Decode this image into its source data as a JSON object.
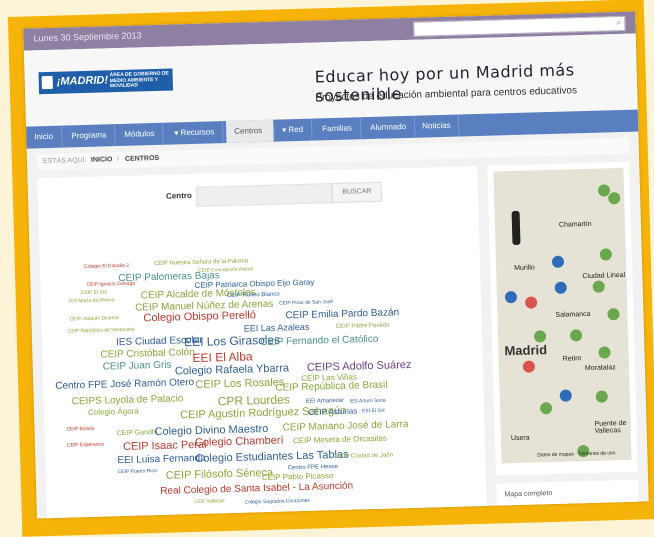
{
  "topbar": {
    "date": "Lunes 30 Septiembre 2013",
    "search_placeholder": ""
  },
  "logo": {
    "madrid": "¡MADRID!",
    "area": "ÁREA DE GOBIERNO DE MEDIO AMBIENTE Y MOVILIDAD"
  },
  "site": {
    "title": "Educar hoy por un Madrid más sostenible",
    "subtitle": "Proyectos de educación ambiental para centros educativos"
  },
  "nav": {
    "items": [
      "Inicio",
      "Programa",
      "Módulos",
      "▾ Recursos",
      "Centros",
      "▾ Red",
      "Familias",
      "Alumnado",
      "Noticias"
    ]
  },
  "breadcrumb": {
    "prefix": "ESTÁS AQUÍ:",
    "home": "INICIO",
    "sep": "/",
    "current": "CENTROS"
  },
  "search": {
    "label": "Centro",
    "button": "BUSCAR"
  },
  "centros": [
    {
      "name": "Colegio El Estudio 2",
      "color": "#c0392b"
    },
    {
      "name": "CEIP Nuestra Señora de la Paloma",
      "color": "#8aa83a"
    },
    {
      "name": "CEIP Concepción Arenal",
      "color": "#8aa83a"
    },
    {
      "name": "CEIP Palomeras Bajas",
      "color": "#4a8f8f"
    },
    {
      "name": "CEIP Ignacio Zuloaga",
      "color": "#c0392b"
    },
    {
      "name": "CEIP Patriarca Obispo Eijo Garay",
      "color": "#2e5e9e"
    },
    {
      "name": "CEIP El Sol",
      "color": "#8aa83a"
    },
    {
      "name": "CEIP Alcalde de Móstoles",
      "color": "#8aa83a"
    },
    {
      "name": "CEIP Rufino Blanco",
      "color": "#2e5e9e"
    },
    {
      "name": "IES María de Molina",
      "color": "#8aa83a"
    },
    {
      "name": "CEIP Manuel Núñez de Arenas",
      "color": "#8aa83a"
    },
    {
      "name": "CEIP Pinar de San José",
      "color": "#2e5e9e"
    },
    {
      "name": "CEIP Joaquín Dicenta",
      "color": "#8aa83a"
    },
    {
      "name": "Colegio Obispo Perelló",
      "color": "#c0392b"
    },
    {
      "name": "CEIP Emilia Pardo Bazán",
      "color": "#2e5e9e"
    },
    {
      "name": "CEIP República de Venezuela",
      "color": "#8aa83a"
    },
    {
      "name": "EEI Las Azaleas",
      "color": "#2e5e9e"
    },
    {
      "name": "CEIP Padre Poveda",
      "color": "#8aa83a"
    },
    {
      "name": "IES Ciudad Escolar",
      "color": "#2e5e9e"
    },
    {
      "name": "EEI Los Girasoles",
      "color": "#2e5e9e"
    },
    {
      "name": "CEIP Fernando el Católico",
      "color": "#4a8f8f"
    },
    {
      "name": "CEIP Cristóbal Colón",
      "color": "#8aa83a"
    },
    {
      "name": "EEI El Alba",
      "color": "#c0392b"
    },
    {
      "name": "CEIP Juan Gris",
      "color": "#4a8f8f"
    },
    {
      "name": "Colegio Rafaela Ybarra",
      "color": "#2e5e9e"
    },
    {
      "name": "CEIPS Adolfo Suárez",
      "color": "#6a3d8f"
    },
    {
      "name": "CEIP Las Viñas",
      "color": "#8aa83a"
    },
    {
      "name": "Centro FPE José Ramón Otero",
      "color": "#2e5e9e"
    },
    {
      "name": "CEIP Los Rosales",
      "color": "#8aa83a"
    },
    {
      "name": "CEIP República de Brasil",
      "color": "#8aa83a"
    },
    {
      "name": "CEIPS Loyola de Palacio",
      "color": "#8aa83a"
    },
    {
      "name": "CPR Lourdes",
      "color": "#8aa83a"
    },
    {
      "name": "EEI Amanecer",
      "color": "#2e5e9e"
    },
    {
      "name": "IES Arturo Soria",
      "color": "#2e5e9e"
    },
    {
      "name": "Colegio Ágora",
      "color": "#8aa83a"
    },
    {
      "name": "CEIP Agustín Rodríguez Sahagún",
      "color": "#8aa83a"
    },
    {
      "name": "CEIP Asturias",
      "color": "#2e5e9e"
    },
    {
      "name": "EEI El Sol",
      "color": "#2e5e9e"
    },
    {
      "name": "CEIP Bolivia",
      "color": "#c0392b"
    },
    {
      "name": "CEIP Gandhi",
      "color": "#8aa83a"
    },
    {
      "name": "Colegio Divino Maestro",
      "color": "#2e5e9e"
    },
    {
      "name": "CEIP Mariano José de Larra",
      "color": "#8aa83a"
    },
    {
      "name": "CEIP Esperanza",
      "color": "#c0392b"
    },
    {
      "name": "CEIP Isaac Peral",
      "color": "#c0392b"
    },
    {
      "name": "Colegio Chamberí",
      "color": "#c0392b"
    },
    {
      "name": "CEIP Meseta de Orcasitas",
      "color": "#8aa83a"
    },
    {
      "name": "EEI Luisa Fernanda",
      "color": "#2e5e9e"
    },
    {
      "name": "Colegio Estudiantes Las Tablas",
      "color": "#2e5e9e"
    },
    {
      "name": "CEIP Ciudad de Jaén",
      "color": "#8aa83a"
    },
    {
      "name": "CEIP Puerto Rico",
      "color": "#2e5e9e"
    },
    {
      "name": "CEIP Filósofo Séneca",
      "color": "#8aa83a"
    },
    {
      "name": "Centro FPE Hease",
      "color": "#2e5e9e"
    },
    {
      "name": "CEIP Pablo Picasso",
      "color": "#8aa83a"
    },
    {
      "name": "Real Colegio de Santa Isabel - La Asunción",
      "color": "#c0392b"
    },
    {
      "name": "CEE Vallecas",
      "color": "#8aa83a"
    },
    {
      "name": "Colegio Sagrados Corazones",
      "color": "#2e5e9e"
    }
  ],
  "map": {
    "labels": [
      "Chamartín",
      "Murillo",
      "Ciudad Lineal",
      "Salamanca",
      "Madrid",
      "Retiro",
      "Moratalaz",
      "Puente de Vallecas",
      "Usera"
    ],
    "legal": "Datos de mapas · Términos de uso"
  },
  "mapa_link": "Mapa completo"
}
